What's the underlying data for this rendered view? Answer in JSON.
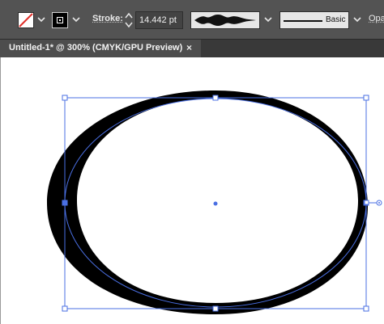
{
  "control_bar": {
    "fill_swatch": {
      "state": "none",
      "color": "#ffffff",
      "slash_color": "#e0302a"
    },
    "stroke_swatch": {
      "color": "#000000"
    },
    "stroke_label": "Stroke:",
    "stroke_weight": "14.442 pt",
    "variable_width_profile": "width-profile-icon",
    "brush": {
      "label": "Basic"
    },
    "opacity_label": "Opa"
  },
  "document_tab": {
    "title": "Untitled-1* @ 300% (CMYK/GPU Preview)",
    "close_glyph": "×"
  },
  "artwork": {
    "shape": "ellipse",
    "stroke_color": "#000000",
    "selection_color": "#4a6fe3",
    "fill_color": "#ffffff"
  }
}
